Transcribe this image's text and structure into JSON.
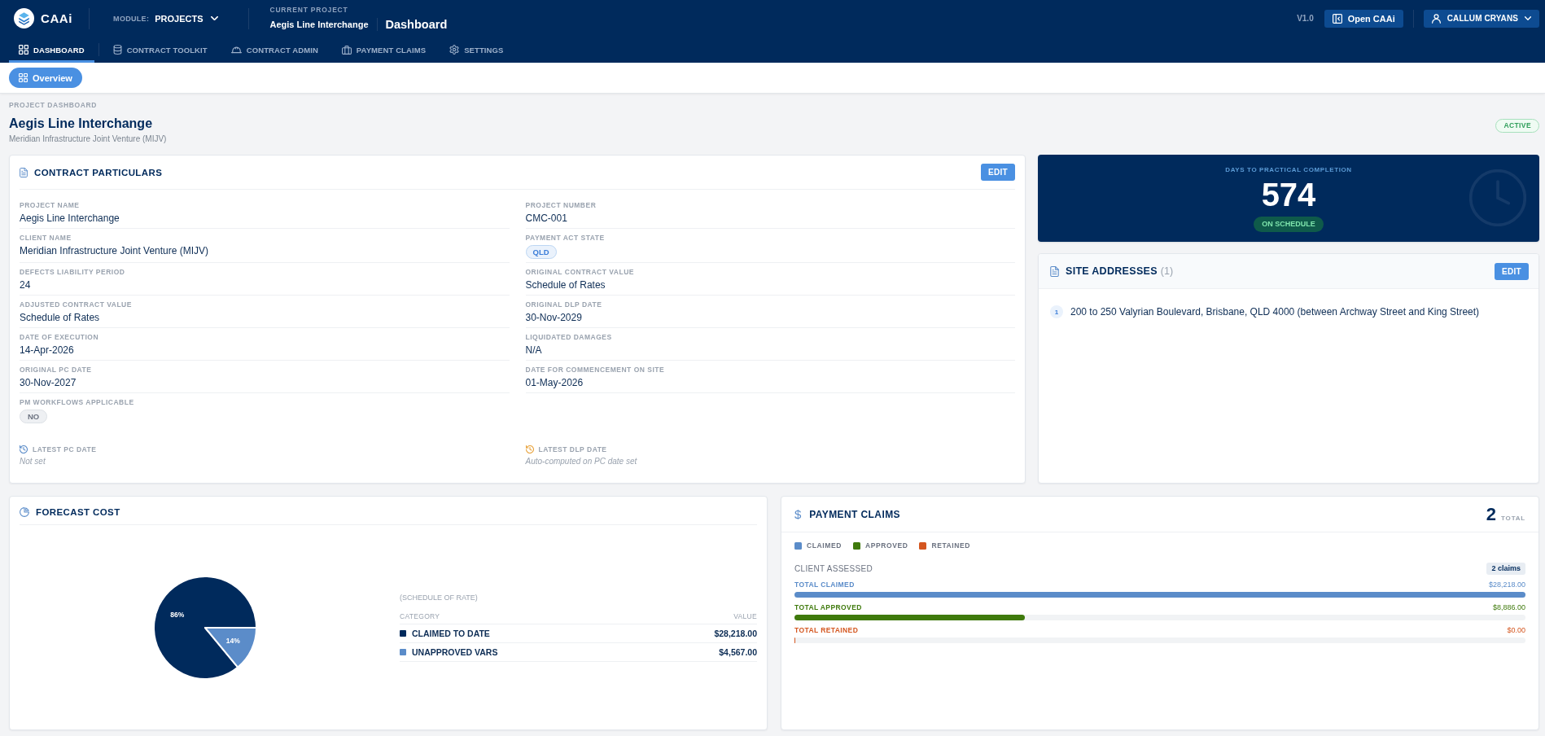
{
  "header": {
    "logo": "CAAi",
    "module_label": "MODULE:",
    "module": "PROJECTS",
    "current_project_label": "CURRENT PROJECT",
    "current_project": "Aegis Line Interchange",
    "page_title": "Dashboard",
    "version": "V1.0",
    "open_button": "Open CAAi",
    "user": "CALLUM CRYANS"
  },
  "nav_tabs": [
    {
      "label": "DASHBOARD",
      "selected": true
    },
    {
      "label": "CONTRACT TOOLKIT",
      "selected": false
    },
    {
      "label": "CONTRACT ADMIN",
      "selected": false
    },
    {
      "label": "PAYMENT CLAIMS",
      "selected": false
    },
    {
      "label": "SETTINGS",
      "selected": false
    }
  ],
  "sub_tabs": [
    {
      "label": "Overview",
      "selected": true
    }
  ],
  "project": {
    "eyebrow": "PROJECT DASHBOARD",
    "title": "Aegis Line Interchange",
    "client": "Meridian Infrastructure Joint Venture (MIJV)",
    "status": "ACTIVE"
  },
  "contract_particulars": {
    "title": "CONTRACT PARTICULARS",
    "edit_button": "EDIT",
    "fields": [
      {
        "label": "PROJECT NAME",
        "value": "Aegis Line Interchange",
        "kind": "text"
      },
      {
        "label": "PROJECT NUMBER",
        "value": "CMC-001",
        "kind": "text"
      },
      {
        "label": "CLIENT NAME",
        "value": "Meridian Infrastructure Joint Venture (MIJV)",
        "kind": "text"
      },
      {
        "label": "PAYMENT ACT STATE",
        "value": "QLD",
        "kind": "tag"
      },
      {
        "label": "DEFECTS LIABILITY PERIOD",
        "value": "24",
        "kind": "text"
      },
      {
        "label": "ORIGINAL CONTRACT VALUE",
        "value": "Schedule of Rates",
        "kind": "text"
      },
      {
        "label": "ADJUSTED CONTRACT VALUE",
        "value": "Schedule of Rates",
        "kind": "text"
      },
      {
        "label": "ORIGINAL DLP DATE",
        "value": "30-Nov-2029",
        "kind": "text"
      },
      {
        "label": "DATE OF EXECUTION",
        "value": "14-Apr-2026",
        "kind": "text"
      },
      {
        "label": "LIQUIDATED DAMAGES",
        "value": "N/A",
        "kind": "text"
      },
      {
        "label": "ORIGINAL PC DATE",
        "value": "30-Nov-2027",
        "kind": "text"
      },
      {
        "label": "DATE FOR COMMENCEMENT ON SITE",
        "value": "01-May-2026",
        "kind": "text"
      },
      {
        "label": "PM WORKFLOWS APPLICABLE",
        "value": "NO",
        "kind": "flag"
      }
    ],
    "latest_dates": [
      {
        "label": "LATEST PC DATE",
        "value": "Not set",
        "color": "#5b8cc9"
      },
      {
        "label": "LATEST DLP DATE",
        "value": "Auto-computed on PC date set",
        "color": "#e8a33d"
      }
    ]
  },
  "days_to_completion": {
    "label": "DAYS TO PRACTICAL COMPLETION",
    "value": "574",
    "status": "ON SCHEDULE"
  },
  "site_addresses": {
    "title": "SITE ADDRESSES",
    "count": "(1)",
    "edit_button": "EDIT",
    "addresses": [
      {
        "number": "1",
        "text": "200 to 250 Valyrian Boulevard, Brisbane, QLD 4000 (between Archway Street and King Street)"
      }
    ]
  },
  "forecast_cost": {
    "title": "FORECAST COST",
    "chart_data": {
      "type": "pie",
      "categories": [
        "CLAIMED TO DATE",
        "UNAPPROVED VARS"
      ],
      "values": [
        86,
        14
      ],
      "value_labels": [
        "86%",
        "14%"
      ]
    },
    "table": {
      "caption": "(SCHEDULE OF RATE)",
      "columns": [
        "CATEGORY",
        "VALUE"
      ],
      "rows": [
        {
          "value": "$28,218.00",
          "color": "#002a5c"
        },
        {
          "value": "$4,567.00",
          "color": "#5b8cc9"
        }
      ]
    }
  },
  "payment_claims": {
    "icon": "$",
    "title": "PAYMENT CLAIMS",
    "total": "2",
    "total_label": "TOTAL",
    "legend": [
      {
        "label": "CLAIMED",
        "color": "#5b8cc9"
      },
      {
        "label": "APPROVED",
        "color": "#3f7a0c"
      },
      {
        "label": "RETAINED",
        "color": "#d4561f"
      }
    ],
    "section": "CLIENT ASSESSED",
    "claims_badge": "2 claims",
    "bars": [
      {
        "label": "TOTAL CLAIMED",
        "value": "$28,218.00",
        "level": 1,
        "color": "#5b8cc9"
      },
      {
        "label": "TOTAL APPROVED",
        "value": "$8,886.00",
        "level": 0.315,
        "color": "#3f7a0c"
      },
      {
        "label": "TOTAL RETAINED",
        "value": "$0.00",
        "level": 0,
        "color": "#d4561f"
      }
    ]
  }
}
